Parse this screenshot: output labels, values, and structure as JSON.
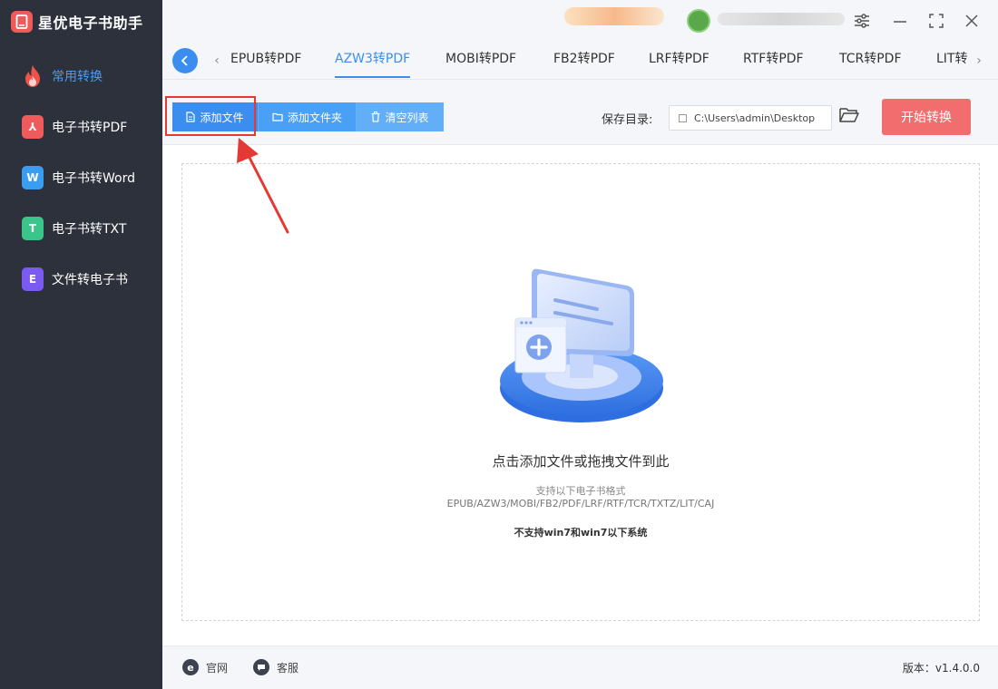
{
  "app": {
    "title": "星优电子书助手",
    "logo_icon": "ebook-app-icon",
    "accent": "#3b8ef0",
    "sidebar_bg": "#2c313b",
    "start_color": "#f26d6d"
  },
  "sidebar": {
    "items": [
      {
        "label": "常用转换",
        "icon": "fire-icon",
        "active": true
      },
      {
        "label": "电子书转PDF",
        "icon": "pdf-icon",
        "glyph": "⅄",
        "color": "#f05a5a"
      },
      {
        "label": "电子书转Word",
        "icon": "word-icon",
        "glyph": "W",
        "color": "#3b9df0"
      },
      {
        "label": "电子书转TXT",
        "icon": "txt-icon",
        "glyph": "T",
        "color": "#3cc58a"
      },
      {
        "label": "文件转电子书",
        "icon": "ebook-icon",
        "glyph": "E",
        "color": "#7a5af0"
      }
    ]
  },
  "tabs": {
    "items": [
      "EPUB转PDF",
      "AZW3转PDF",
      "MOBI转PDF",
      "FB2转PDF",
      "LRF转PDF",
      "RTF转PDF",
      "TCR转PDF",
      "LIT转"
    ],
    "active": 1
  },
  "toolbar": {
    "add_file": "添加文件",
    "add_folder": "添加文件夹",
    "clear_list": "清空列表",
    "save_dir_label": "保存目录:",
    "save_dir_value": "C:\\Users\\admin\\Desktop",
    "start": "开始转换"
  },
  "dropzone": {
    "main_text": "点击添加文件或拖拽文件到此",
    "sub_text": "支持以下电子书格式",
    "formats": "EPUB/AZW3/MOBI/FB2/PDF/LRF/RTF/TCR/TXTZ/LIT/CAJ",
    "warning": "不支持win7和win7以下系统"
  },
  "footer": {
    "website": "官网",
    "support": "客服",
    "version": "版本：v1.4.0.0"
  }
}
